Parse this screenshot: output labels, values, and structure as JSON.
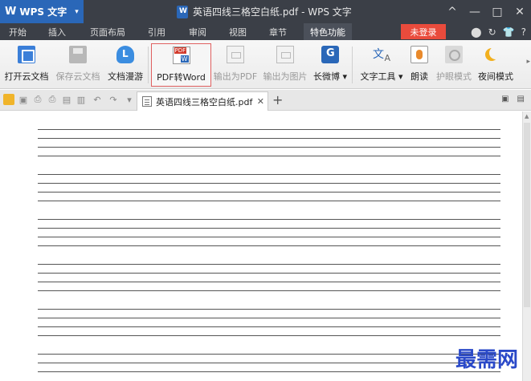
{
  "titlebar": {
    "app_name": "WPS 文字",
    "app_logo": "W",
    "doc_title": "英语四线三格空白纸.pdf - WPS 文字",
    "controls": [
      "^",
      "—",
      "□",
      "✕"
    ]
  },
  "menu": {
    "items": [
      {
        "label": "开始"
      },
      {
        "label": "插入"
      },
      {
        "label": "页面布局"
      },
      {
        "label": "引用"
      },
      {
        "label": "审阅"
      },
      {
        "label": "视图"
      },
      {
        "label": "章节"
      },
      {
        "label": "特色功能"
      }
    ],
    "active": "特色功能",
    "login_label": "未登录",
    "right_icons": [
      "⬤",
      "↻",
      "👕",
      "?"
    ]
  },
  "ribbon": {
    "buttons": [
      {
        "label": "打开云文档",
        "icon": "cloud-open-icon",
        "enabled": true
      },
      {
        "label": "保存云文档",
        "icon": "save-icon",
        "enabled": false
      },
      {
        "label": "文档漫游",
        "icon": "cloud-icon",
        "enabled": true
      },
      {
        "label": "PDF转Word",
        "icon": "pdf-to-word-icon",
        "enabled": true,
        "selected": true
      },
      {
        "label": "输出为PDF",
        "icon": "export-pdf-icon",
        "enabled": false
      },
      {
        "label": "输出为图片",
        "icon": "export-image-icon",
        "enabled": false
      },
      {
        "label": "长微博",
        "icon": "weibo-icon",
        "enabled": true
      },
      {
        "label": "文字工具",
        "icon": "text-tools-icon",
        "enabled": true
      },
      {
        "label": "朗读",
        "icon": "read-aloud-icon",
        "enabled": true
      },
      {
        "label": "护眼模式",
        "icon": "eye-care-icon",
        "enabled": false
      },
      {
        "label": "夜间模式",
        "icon": "night-mode-icon",
        "enabled": true
      }
    ]
  },
  "tabs": {
    "doc_tab_label": "英语四线三格空白纸.pdf",
    "close": "✕",
    "add": "+"
  },
  "watermark": "最需网",
  "colors": {
    "titlebar": "#3b3f47",
    "app_button": "#2a67b8",
    "login": "#e94b3c",
    "watermark": "#2a49c8"
  }
}
